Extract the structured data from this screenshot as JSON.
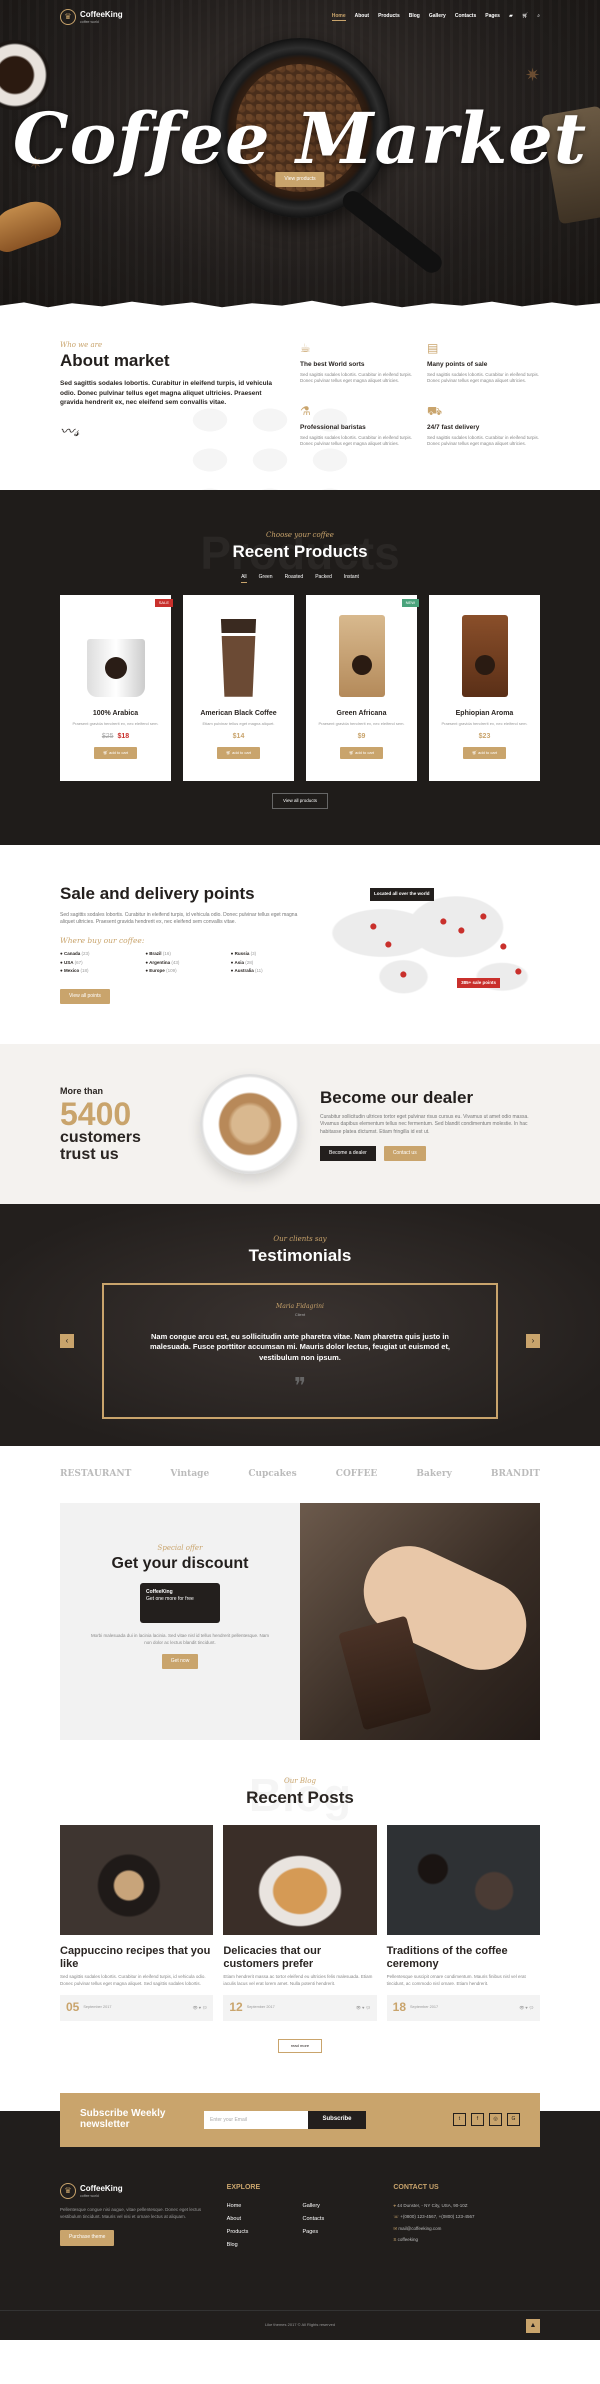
{
  "brand": {
    "name": "CoffeeKing",
    "tagline": "coffee world"
  },
  "nav": {
    "items": [
      "Home",
      "About",
      "Products",
      "Blog",
      "Gallery",
      "Contacts",
      "Pages"
    ],
    "active": "Home"
  },
  "hero": {
    "title": "Coffee Market",
    "button": "View products"
  },
  "about": {
    "kicker": "Who we are",
    "title": "About market",
    "text": "Sed sagittis sodales lobortis. Curabitur in eleifend turpis, id vehicula odio. Donec pulvinar tellus eget magna aliquet ultricies. Praesent gravida hendrerit ex, nec eleifend sem convallis vitae.",
    "signature": "Owner",
    "features": [
      {
        "icon": "coffee-cup-icon",
        "title": "The best World sorts",
        "text": "Sed sagittis sodales lobortis. Curabitur in eleifend turpis. Donec pulvinar tellus eget magna aliquet ultricies."
      },
      {
        "icon": "menu-board-icon",
        "title": "Many points of sale",
        "text": "Sed sagittis sodales lobortis. Curabitur in eleifend turpis. Donec pulvinar tellus eget magna aliquet ultricies."
      },
      {
        "icon": "coffee-press-icon",
        "title": "Professional baristas",
        "text": "Sed sagittis sodales lobortis. Curabitur in eleifend turpis. Donec pulvinar tellus eget magna aliquet ultricies."
      },
      {
        "icon": "delivery-truck-icon",
        "title": "24/7 fast delivery",
        "text": "Sed sagittis sodales lobortis. Curabitur in eleifend turpis. Donec pulvinar tellus eget magna aliquet ultricies."
      }
    ]
  },
  "products": {
    "ghost": "Products",
    "kicker": "Choose your coffee",
    "title": "Recent Products",
    "filters": [
      "All",
      "Green",
      "Roasted",
      "Packed",
      "Instant"
    ],
    "items": [
      {
        "name": "100% Arabica",
        "desc": "Praesent gravida hendrerit ex, nec eleifend sem.",
        "old_price": "$25",
        "price": "$18",
        "badge": "SALE",
        "button": "add to cart"
      },
      {
        "name": "American Black Coffee",
        "desc": "Etiam pulvinar tellus eget magna aliquet.",
        "old_price": "",
        "price": "$14",
        "badge": "",
        "button": "add to cart"
      },
      {
        "name": "Green Africana",
        "desc": "Praesent gravida hendrerit ex, nec eleifend sem.",
        "old_price": "",
        "price": "$9",
        "badge": "NEW",
        "button": "add to cart"
      },
      {
        "name": "Ephiopian Aroma",
        "desc": "Praesent gravida hendrerit ex, nec eleifend sem.",
        "old_price": "",
        "price": "$23",
        "badge": "",
        "button": "add to cart"
      }
    ],
    "view_all": "View all products"
  },
  "sale": {
    "title": "Sale and delivery points",
    "text": "Sed sagittis sodales lobortis. Curabitur in eleifend turpis, id vehicula odio. Donec pulvinar tellus eget magna aliquet ultricies. Praesent gravida hendrerit ex, nec eleifend sem convallis vitae.",
    "subtitle": "Where buy our coffee:",
    "points": [
      {
        "name": "Canada",
        "count": "(23)"
      },
      {
        "name": "Brazil",
        "count": "(16)"
      },
      {
        "name": "Russia",
        "count": "(3)"
      },
      {
        "name": "USA",
        "count": "(67)"
      },
      {
        "name": "Argentina",
        "count": "(43)"
      },
      {
        "name": "Asia",
        "count": "(28)"
      },
      {
        "name": "Mexico",
        "count": "(18)"
      },
      {
        "name": "Europe",
        "count": "(109)"
      },
      {
        "name": "Australia",
        "count": "(11)"
      }
    ],
    "button": "View all points",
    "map_label_1": "Located all over the world",
    "map_label_2": "385+ sale points"
  },
  "dealer": {
    "more_than": "More than",
    "number": "5400",
    "customers": "customers",
    "trust": "trust us",
    "title": "Become our dealer",
    "text": "Curabitur sollicitudin ultrices tortor eget pulvinar risus cursus eu. Vivamus ut amet odio massa. Vivamus dapibus elementum tellus nec fermentum. Sed blandit condimentum molestie. In hac habitasse platea dictumst. Etiam fringilla id est ut.",
    "btn1": "Become a dealer",
    "btn2": "Contact us"
  },
  "testimonials": {
    "kicker": "Our clients say",
    "title": "Testimonials",
    "name": "Maria Fidagrini",
    "role": "Client",
    "quote": "Nam congue arcu est, eu sollicitudin ante pharetra vitae. Nam pharetra quis justo in malesuada. Fusce porttitor accumsan mi. Mauris dolor lectus, feugiat ut euismod et, vestibulum non ipsum."
  },
  "brands": [
    "RESTAURANT",
    "Vintage",
    "Cupcakes",
    "COFFEE",
    "Bakery",
    "BRANDIT"
  ],
  "discount": {
    "kicker": "Special offer",
    "title": "Get your discount",
    "card_name": "CoffeeKing",
    "card_text": "Get one more for free",
    "text": "Morbi malesuada dui in lacinia lacinia. Sed vitae nisl id tellus hendrerit pellentesque. Nam non dolor ac lectus blandit tincidunt.",
    "button": "Get now"
  },
  "blog": {
    "ghost": "Blog",
    "kicker": "Our Blog",
    "title": "Recent Posts",
    "posts": [
      {
        "title": "Cappuccino recipes that you like",
        "text": "Sed sagittis sodales lobortis. Curabitur in eleifend turpis, id vehicula odio. Donec pulvinar tellus eget magna aliquet. Sed sagittis sodales lobortis.",
        "day": "05",
        "month": "September 2017"
      },
      {
        "title": "Delicacies that our customers prefer",
        "text": "Etiam hendrerit massa ac tortor eleifend eu ultricies felis malesuada. Etiam iaculis lacus vel erat lorem amet. Nulla potenti hendrerit.",
        "day": "12",
        "month": "September 2017"
      },
      {
        "title": "Traditions of the coffee ceremony",
        "text": "Pellentesque suscipit ornare condimentum. Mauris finibus nisl vel erat tincidunt, ac commodo nisl ornare. Etiam hendrerit.",
        "day": "18",
        "month": "September 2017"
      }
    ],
    "read_more": "read more"
  },
  "newsletter": {
    "title": "Subscribe Weekly newsletter",
    "placeholder": "Enter your Email",
    "button": "Subscribe"
  },
  "footer": {
    "about": "Pellentesque congue nisi augue, vitae pellentesque. Donec eget lectus vestibulum tincidunt. Mauris vel nisi et ornare lectus at aliquam.",
    "about_button": "Purchase theme",
    "explore_title": "EXPLORE",
    "links": [
      "Home",
      "Gallery",
      "About",
      "Contacts",
      "Products",
      "Pages",
      "Blog"
    ],
    "contact_title": "CONTACT US",
    "contacts": [
      "44 Dunster, - NY City, USA, 90-10Z",
      "+(0800) 123-4567, +(0800) 123-4567",
      "mail@coffeeking.com",
      "coffeeking"
    ],
    "copyright": "Like themes 2017 © All Rights reserved"
  },
  "colors": {
    "accent": "#c9a46c",
    "dark": "#231f1d",
    "sale": "#c9302c",
    "new": "#4aa37c"
  }
}
